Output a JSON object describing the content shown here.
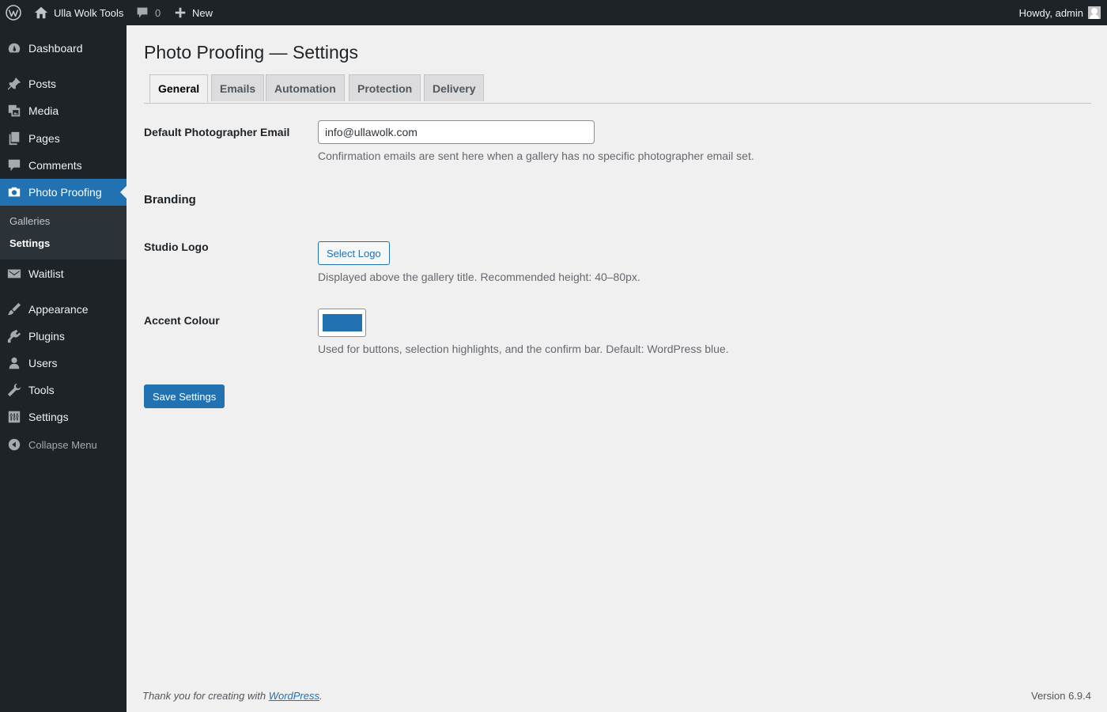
{
  "adminbar": {
    "site_name": "Ulla Wolk Tools",
    "comments_count": "0",
    "new_label": "New",
    "howdy": "Howdy, admin"
  },
  "sidebar": {
    "items": [
      {
        "label": "Dashboard",
        "icon": "dashboard-icon"
      },
      {
        "label": "Posts",
        "icon": "pin-icon"
      },
      {
        "label": "Media",
        "icon": "media-icon"
      },
      {
        "label": "Pages",
        "icon": "pages-icon"
      },
      {
        "label": "Comments",
        "icon": "comment-icon"
      },
      {
        "label": "Photo Proofing",
        "icon": "camera-icon"
      },
      {
        "label": "Waitlist",
        "icon": "envelope-icon"
      },
      {
        "label": "Appearance",
        "icon": "brush-icon"
      },
      {
        "label": "Plugins",
        "icon": "plug-icon"
      },
      {
        "label": "Users",
        "icon": "user-icon"
      },
      {
        "label": "Tools",
        "icon": "wrench-icon"
      },
      {
        "label": "Settings",
        "icon": "settings-icon"
      }
    ],
    "submenu": [
      "Galleries",
      "Settings"
    ],
    "collapse_label": "Collapse Menu"
  },
  "page": {
    "title": "Photo Proofing — Settings",
    "tabs": [
      "General",
      "Emails",
      "Automation",
      "Protection",
      "Delivery"
    ],
    "active_tab": "General"
  },
  "form": {
    "email_label": "Default Photographer Email",
    "email_value": "info@ullawolk.com",
    "email_desc": "Confirmation emails are sent here when a gallery has no specific photographer email set.",
    "branding_title": "Branding",
    "logo_label": "Studio Logo",
    "logo_button": "Select Logo",
    "logo_desc": "Displayed above the gallery title. Recommended height: 40–80px.",
    "accent_label": "Accent Colour",
    "accent_color": "#2271b1",
    "accent_desc": "Used for buttons, selection highlights, and the confirm bar. Default: WordPress blue.",
    "save_button": "Save Settings"
  },
  "footer": {
    "thanks_prefix": "Thank you for creating with ",
    "thanks_link": "WordPress",
    "thanks_suffix": ".",
    "version": "Version 6.9.4"
  },
  "colors": {
    "admin_bg": "#1d2327",
    "accent": "#2271b1",
    "page_bg": "#f0f0f1"
  }
}
